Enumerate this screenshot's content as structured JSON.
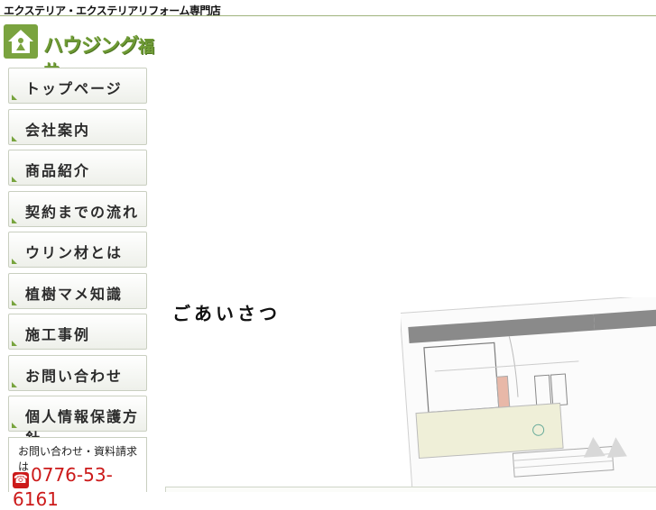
{
  "header": {
    "tagline": "エクステリア・エクステリアリフォーム専門店",
    "logo_name": "ハウジング",
    "logo_city": "福井"
  },
  "nav": {
    "items": [
      {
        "label": "トップページ"
      },
      {
        "label": "会社案内"
      },
      {
        "label": "商品紹介"
      },
      {
        "label": "契約までの流れ"
      },
      {
        "label": "ウリン材とは"
      },
      {
        "label": "植樹マメ知識"
      },
      {
        "label": "施工事例"
      },
      {
        "label": "お問い合わせ"
      },
      {
        "label": "個人情報保護方針"
      }
    ]
  },
  "contact": {
    "title": "お問い合わせ・資料請求は",
    "phone": "0776-53-6161"
  },
  "main": {
    "greeting": "ごあいさつ"
  },
  "colors": {
    "brand_green": "#7aa33f",
    "phone_red": "#cc1a1a"
  }
}
